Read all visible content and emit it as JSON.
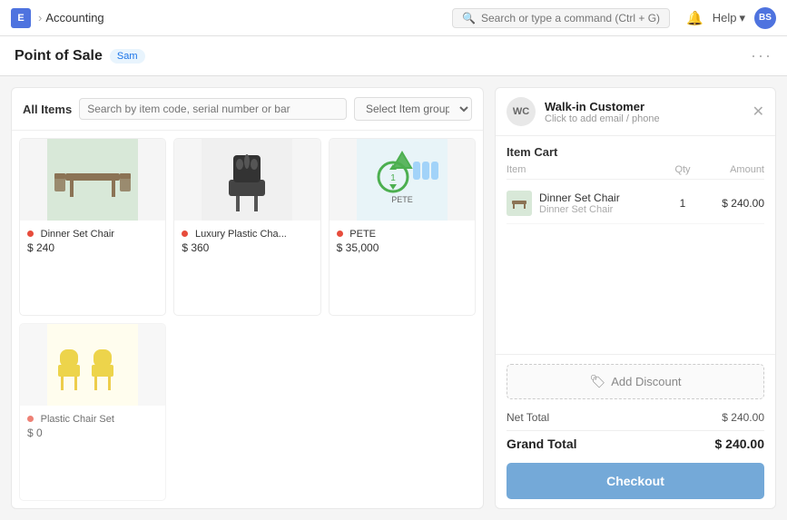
{
  "app": {
    "icon": "E",
    "breadcrumb": {
      "parent": "Accounting",
      "separator": "›"
    }
  },
  "topbar": {
    "search_placeholder": "Search or type a command (Ctrl + G)",
    "help_label": "Help",
    "help_chevron": "▾",
    "avatar": "BS"
  },
  "page": {
    "title": "Point of Sale",
    "tag": "Sam",
    "more": "···"
  },
  "items_panel": {
    "title": "All Items",
    "search_placeholder": "Search by item code, serial number or bar",
    "group_placeholder": "Select Item group",
    "items": [
      {
        "id": "dinner-set-chair",
        "name": "Dinner Set Chair",
        "price": "$ 240",
        "dot_color": "red",
        "img_bg": "#d9e8d9"
      },
      {
        "id": "luxury-plastic-chair",
        "name": "Luxury Plastic Cha...",
        "price": "$ 360",
        "dot_color": "red",
        "img_bg": "#e8e8e8"
      },
      {
        "id": "pete",
        "name": "PETE",
        "price": "$ 35,000",
        "dot_color": "red",
        "img_bg": "#e8f4f8"
      },
      {
        "id": "plastic-chair-set",
        "name": "Plastic Chair Set",
        "price": "$ 0",
        "dot_color": "red",
        "img_bg": "#fffde8"
      }
    ]
  },
  "cart": {
    "customer_initials": "WC",
    "customer_name": "Walk-in Customer",
    "customer_sub": "Click to add email / phone",
    "cart_title": "Item Cart",
    "columns": {
      "item": "Item",
      "qty": "Qty",
      "amount": "Amount"
    },
    "rows": [
      {
        "name": "Dinner Set Chair",
        "sub": "Dinner Set Chair",
        "qty": "1",
        "amount": "$ 240.00"
      }
    ],
    "add_discount": "Add Discount",
    "net_total_label": "Net Total",
    "net_total_value": "$ 240.00",
    "grand_total_label": "Grand Total",
    "grand_total_value": "$ 240.00",
    "checkout_label": "Checkout"
  }
}
